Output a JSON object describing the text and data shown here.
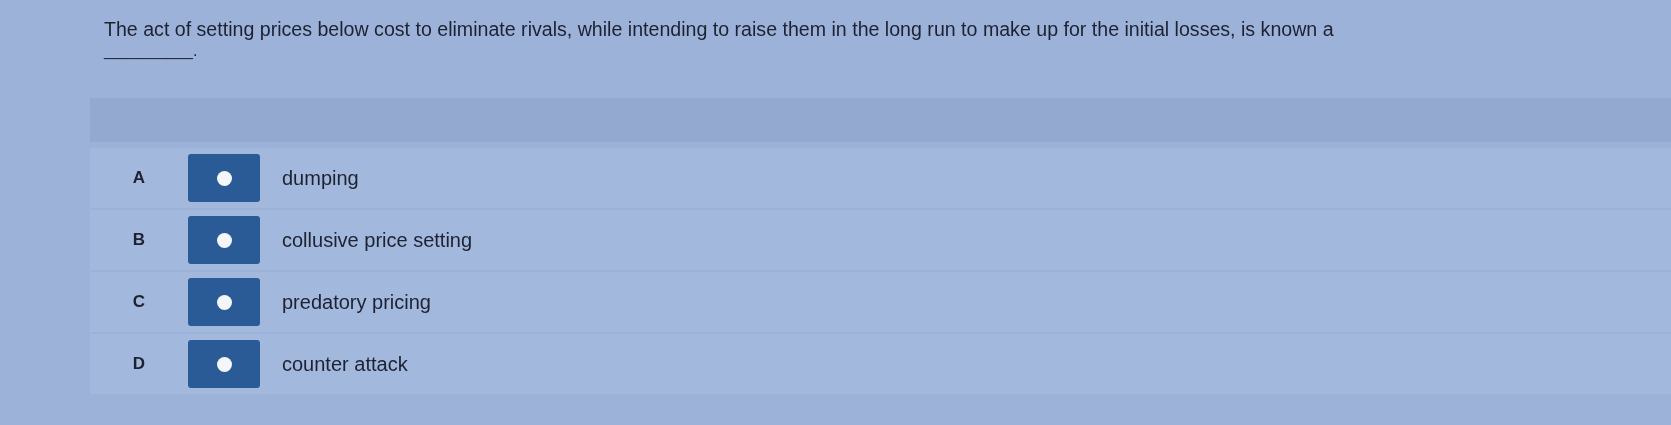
{
  "question": {
    "text": "The act of setting prices below cost to eliminate rivals, while intending to raise them in the long run to make up for the initial losses, is known a",
    "blank": "__________."
  },
  "options": [
    {
      "letter": "A",
      "text": "dumping",
      "selected": false
    },
    {
      "letter": "B",
      "text": "collusive price setting",
      "selected": false
    },
    {
      "letter": "C",
      "text": "predatory pricing",
      "selected": false
    },
    {
      "letter": "D",
      "text": "counter attack",
      "selected": false
    }
  ]
}
